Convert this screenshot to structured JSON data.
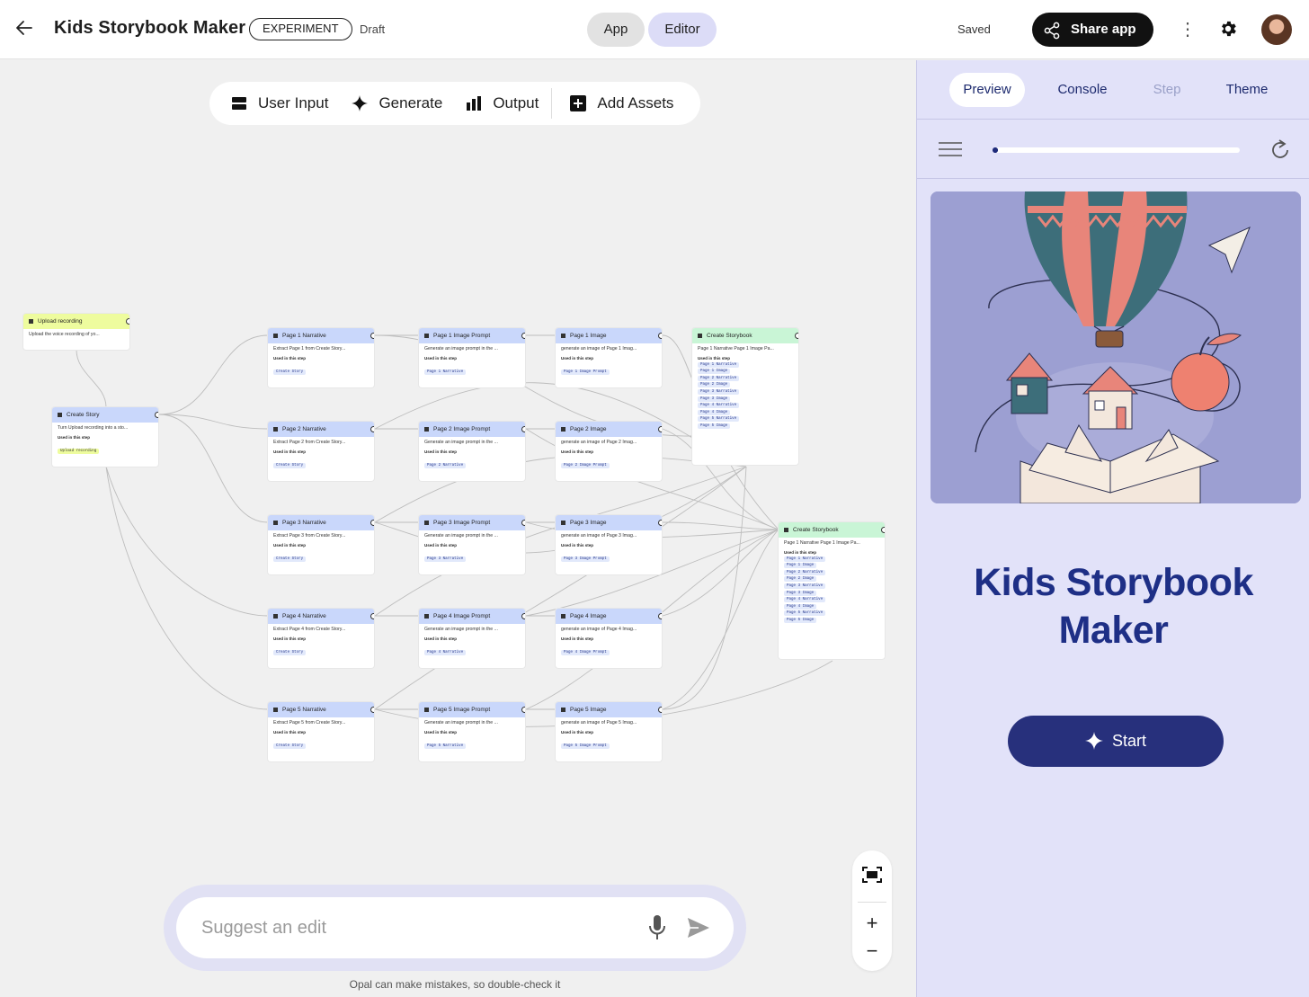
{
  "header": {
    "app_title": "Kids Storybook Maker",
    "badge": "EXPERIMENT",
    "status": "Draft",
    "mode_app": "App",
    "mode_editor": "Editor",
    "saved": "Saved",
    "share_label": "Share app"
  },
  "toolbar": {
    "user_input": "User Input",
    "generate": "Generate",
    "output": "Output",
    "add_assets": "Add Assets"
  },
  "nodes": {
    "upload": {
      "title": "Upload recording",
      "desc": "Upload the voice recording of yo..."
    },
    "create_story": {
      "title": "Create Story",
      "desc": "Turn Upload recording into a sto...",
      "used": "Used in this step",
      "chip": "Upload recording"
    },
    "narratives": [
      {
        "title": "Page 1 Narrative",
        "desc": "Extract Page 1 from Create Story...",
        "used": "Used in this step",
        "chip": "Create Story"
      },
      {
        "title": "Page 2 Narrative",
        "desc": "Extract Page 2 from Create Story...",
        "used": "Used in this step",
        "chip": "Create Story"
      },
      {
        "title": "Page 3 Narrative",
        "desc": "Extract Page 3 from Create Story...",
        "used": "Used in this step",
        "chip": "Create Story"
      },
      {
        "title": "Page 4 Narrative",
        "desc": "Extract Page 4 from Create Story...",
        "used": "Used in this step",
        "chip": "Create Story"
      },
      {
        "title": "Page 5 Narrative",
        "desc": "Extract Page 5 from Create Story...",
        "used": "Used in this step",
        "chip": "Create Story"
      }
    ],
    "prompts": [
      {
        "title": "Page 1 Image Prompt",
        "desc": "Generate an image prompt in the ...",
        "used": "Used in this step",
        "chip": "Page 1 Narrative"
      },
      {
        "title": "Page 2 Image Prompt",
        "desc": "Generate an image prompt in the ...",
        "used": "Used in this step",
        "chip": "Page 2 Narrative"
      },
      {
        "title": "Page 3 Image Prompt",
        "desc": "Generate an image prompt in the ...",
        "used": "Used in this step",
        "chip": "Page 3 Narrative"
      },
      {
        "title": "Page 4 Image Prompt",
        "desc": "Generate an image prompt in the ...",
        "used": "Used in this step",
        "chip": "Page 4 Narrative"
      },
      {
        "title": "Page 5 Image Prompt",
        "desc": "Generate an image prompt in the ...",
        "used": "Used in this step",
        "chip": "Page 5 Narrative"
      }
    ],
    "images": [
      {
        "title": "Page 1 Image",
        "desc": "generate an image of Page 1 Imag...",
        "used": "Used in this step",
        "chip": "Page 1 Image Prompt"
      },
      {
        "title": "Page 2 Image",
        "desc": "generate an image of Page 2 Imag...",
        "used": "Used in this step",
        "chip": "Page 2 Image Prompt"
      },
      {
        "title": "Page 3 Image",
        "desc": "generate an image of Page 3 Imag...",
        "used": "Used in this step",
        "chip": "Page 3 Image Prompt"
      },
      {
        "title": "Page 4 Image",
        "desc": "generate an image of Page 4 Imag...",
        "used": "Used in this step",
        "chip": "Page 4 Image Prompt"
      },
      {
        "title": "Page 5 Image",
        "desc": "generate an image of Page 5 Imag...",
        "used": "Used in this step",
        "chip": "Page 5 Image Prompt"
      }
    ],
    "storybook_a": {
      "title": "Create Storybook",
      "desc": "Page 1 Narrative Page 1 Image Pa...",
      "used": "Used in this step"
    },
    "storybook_b": {
      "title": "Create Storybook",
      "desc": "Page 1 Narrative Page 1 Image Pa...",
      "used": "Used in this step"
    },
    "storybook_chips": [
      "Page 1 Narrative",
      "Page 1 Image",
      "Page 2 Narrative",
      "Page 2 Image",
      "Page 3 Narrative",
      "Page 3 Image",
      "Page 4 Narrative",
      "Page 4 Image",
      "Page 5 Narrative",
      "Page 5 Image"
    ]
  },
  "suggest": {
    "placeholder": "Suggest an edit",
    "disclaimer": "Opal can make mistakes, so double-check it"
  },
  "panel": {
    "tabs": [
      "Preview",
      "Console",
      "Step",
      "Theme"
    ],
    "active_tab": "Preview",
    "progress": 0.02,
    "title": "Kids Storybook Maker",
    "start_label": "Start"
  },
  "colors": {
    "accent": "#27307c",
    "panel_bg": "#e2e2f9",
    "node_header": "#c9d7fb",
    "input_node": "#eefc9e",
    "output_node": "#c9f5d6"
  },
  "icons": [
    "back-arrow-icon",
    "share-icon",
    "more-vert-icon",
    "gear-icon",
    "user-input-icon",
    "sparkle-icon",
    "output-icon",
    "add-box-icon",
    "fit-screen-icon",
    "mic-icon",
    "send-icon",
    "menu-icon",
    "refresh-icon"
  ]
}
